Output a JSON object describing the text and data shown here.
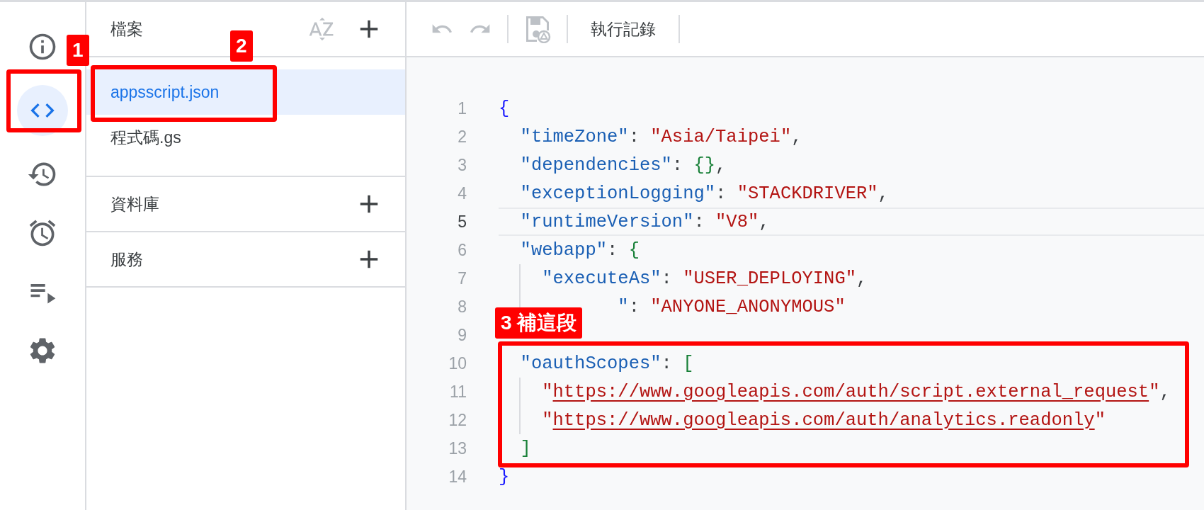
{
  "rail": [
    {
      "kind": "info",
      "selected": false
    },
    {
      "kind": "code",
      "selected": true
    },
    {
      "kind": "history",
      "selected": false
    },
    {
      "kind": "alarm",
      "selected": false
    },
    {
      "kind": "playlist",
      "selected": false
    },
    {
      "kind": "settings",
      "selected": false
    }
  ],
  "files": {
    "title": "檔案",
    "items": [
      {
        "name": "appsscript.json",
        "selected": true
      },
      {
        "name": "程式碼.gs",
        "selected": false
      }
    ]
  },
  "sections": [
    {
      "title": "資料庫"
    },
    {
      "title": "服務"
    }
  ],
  "toolbar": {
    "buttons": [
      {
        "kind": "undo",
        "disabled": true
      },
      {
        "kind": "redo",
        "disabled": true
      },
      {
        "kind": "save",
        "disabled": true
      }
    ],
    "log_button": "執行記錄"
  },
  "editor": {
    "lines": [
      {
        "number": "1",
        "active": false,
        "tokens": [
          {
            "kind": "bracket-outer",
            "text": "{"
          }
        ]
      },
      {
        "number": "2",
        "active": false,
        "tokens": [
          {
            "kind": "key",
            "text": "  \"timeZone\""
          },
          {
            "kind": "punct",
            "text": ": "
          },
          {
            "kind": "string",
            "text": "\"Asia/Taipei\""
          },
          {
            "kind": "punct",
            "text": ","
          }
        ]
      },
      {
        "number": "3",
        "active": false,
        "tokens": [
          {
            "kind": "key",
            "text": "  \"dependencies\""
          },
          {
            "kind": "punct",
            "text": ": "
          },
          {
            "kind": "bracket-inner",
            "text": "{}"
          },
          {
            "kind": "punct",
            "text": ","
          }
        ]
      },
      {
        "number": "4",
        "active": false,
        "tokens": [
          {
            "kind": "key",
            "text": "  \"exceptionLogging\""
          },
          {
            "kind": "punct",
            "text": ": "
          },
          {
            "kind": "string",
            "text": "\"STACKDRIVER\""
          },
          {
            "kind": "punct",
            "text": ","
          }
        ]
      },
      {
        "number": "5",
        "active": true,
        "tokens": [
          {
            "kind": "key",
            "text": "  \"runtimeVersion\""
          },
          {
            "kind": "punct",
            "text": ": "
          },
          {
            "kind": "string",
            "text": "\"V8\""
          },
          {
            "kind": "punct",
            "text": ","
          }
        ]
      },
      {
        "number": "6",
        "active": false,
        "tokens": [
          {
            "kind": "key",
            "text": "  \"webapp\""
          },
          {
            "kind": "punct",
            "text": ": "
          },
          {
            "kind": "bracket-inner",
            "text": "{"
          }
        ]
      },
      {
        "number": "7",
        "active": false,
        "tokens": [
          {
            "kind": "key",
            "text": "    \"executeAs\""
          },
          {
            "kind": "punct",
            "text": ": "
          },
          {
            "kind": "string",
            "text": "\"USER_DEPLOYING\""
          },
          {
            "kind": "punct",
            "text": ","
          }
        ]
      },
      {
        "number": "8",
        "active": false,
        "tokens": [
          {
            "kind": "key",
            "text": "           \""
          },
          {
            "kind": "punct",
            "text": ": "
          },
          {
            "kind": "string",
            "text": "\"ANYONE_ANONYMOUS\""
          }
        ]
      },
      {
        "number": "9",
        "active": false
      },
      {
        "number": "10",
        "active": false,
        "tokens": [
          {
            "kind": "key",
            "text": "  \"oauthScopes\""
          },
          {
            "kind": "punct",
            "text": ": "
          },
          {
            "kind": "bracket-inner",
            "text": "["
          }
        ]
      },
      {
        "number": "11",
        "active": false,
        "tokens": [
          {
            "kind": "string",
            "text": "    \""
          },
          {
            "kind": "url",
            "text": "https://www.googleapis.com/auth/script.external_request"
          },
          {
            "kind": "string",
            "text": "\""
          },
          {
            "kind": "punct",
            "text": ","
          }
        ]
      },
      {
        "number": "12",
        "active": false,
        "tokens": [
          {
            "kind": "string",
            "text": "    \""
          },
          {
            "kind": "url",
            "text": "https://www.googleapis.com/auth/analytics.readonly"
          },
          {
            "kind": "string",
            "text": "\""
          }
        ]
      },
      {
        "number": "13",
        "active": false,
        "tokens": [
          {
            "kind": "bracket-inner",
            "text": "  ]"
          }
        ]
      },
      {
        "number": "14",
        "active": false,
        "tokens": [
          {
            "kind": "bracket-outer",
            "text": "}"
          }
        ]
      }
    ]
  },
  "annotations": [
    {
      "label": "1"
    },
    {
      "label": "2"
    },
    {
      "label": "3 補這段"
    }
  ]
}
